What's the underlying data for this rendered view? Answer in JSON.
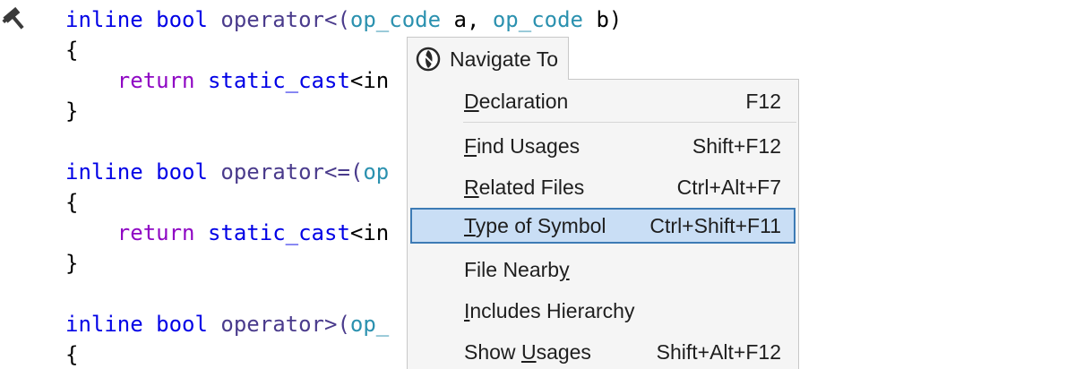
{
  "editor": {
    "gutter_icon": "hammer-icon",
    "lines": [
      {
        "parts": [
          {
            "t": "inline",
            "c": "kw"
          },
          {
            "t": " ",
            "c": "plain"
          },
          {
            "t": "bool",
            "c": "kw"
          },
          {
            "t": " ",
            "c": "plain"
          },
          {
            "t": "operator<(",
            "c": "fn"
          },
          {
            "t": "op_code",
            "c": "ty"
          },
          {
            "t": " a, ",
            "c": "plain"
          },
          {
            "t": "op_code",
            "c": "ty"
          },
          {
            "t": " b)",
            "c": "plain"
          }
        ]
      },
      {
        "parts": [
          {
            "t": "{",
            "c": "plain"
          }
        ]
      },
      {
        "parts": [
          {
            "t": "    ",
            "c": "plain"
          },
          {
            "t": "return",
            "c": "ret"
          },
          {
            "t": " ",
            "c": "plain"
          },
          {
            "t": "static_cast",
            "c": "kw"
          },
          {
            "t": "<in",
            "c": "plain"
          }
        ]
      },
      {
        "parts": [
          {
            "t": "}",
            "c": "plain"
          }
        ]
      },
      {
        "parts": [
          {
            "t": "",
            "c": "plain"
          }
        ]
      },
      {
        "parts": [
          {
            "t": "inline",
            "c": "kw"
          },
          {
            "t": " ",
            "c": "plain"
          },
          {
            "t": "bool",
            "c": "kw"
          },
          {
            "t": " ",
            "c": "plain"
          },
          {
            "t": "operator<=(",
            "c": "fn"
          },
          {
            "t": "op",
            "c": "ty"
          }
        ]
      },
      {
        "parts": [
          {
            "t": "{",
            "c": "plain"
          }
        ]
      },
      {
        "parts": [
          {
            "t": "    ",
            "c": "plain"
          },
          {
            "t": "return",
            "c": "ret"
          },
          {
            "t": " ",
            "c": "plain"
          },
          {
            "t": "static_cast",
            "c": "kw"
          },
          {
            "t": "<in",
            "c": "plain"
          }
        ]
      },
      {
        "parts": [
          {
            "t": "}",
            "c": "plain"
          }
        ]
      },
      {
        "parts": [
          {
            "t": "",
            "c": "plain"
          }
        ]
      },
      {
        "parts": [
          {
            "t": "inline",
            "c": "kw"
          },
          {
            "t": " ",
            "c": "plain"
          },
          {
            "t": "bool",
            "c": "kw"
          },
          {
            "t": " ",
            "c": "plain"
          },
          {
            "t": "operator>(",
            "c": "fn"
          },
          {
            "t": "op_",
            "c": "ty"
          }
        ]
      },
      {
        "parts": [
          {
            "t": "{",
            "c": "plain"
          }
        ]
      }
    ]
  },
  "popup": {
    "header_icon": "resharper-navigate-icon",
    "title": "Navigate To",
    "selected_index": 3,
    "items": [
      {
        "label": "Declaration",
        "shortcut": "F12"
      },
      {
        "label": "Find Usages",
        "shortcut": "Shift+F12"
      },
      {
        "label": "Related Files",
        "shortcut": "Ctrl+Alt+F7"
      },
      {
        "label": "Type of Symbol",
        "shortcut": "Ctrl+Shift+F11"
      },
      {
        "label": "File Nearby",
        "shortcut": ""
      },
      {
        "label": "Includes Hierarchy",
        "shortcut": ""
      },
      {
        "label": "Show Usages",
        "shortcut": "Shift+Alt+F12"
      }
    ]
  },
  "colors": {
    "keyword": "#0000e6",
    "return_keyword": "#8f08c4",
    "function_name": "#4a3b8c",
    "type_name": "#2b91af",
    "selection_background": "#c9def5",
    "selection_border": "#3d7bb5",
    "menu_background": "#f5f5f5"
  }
}
